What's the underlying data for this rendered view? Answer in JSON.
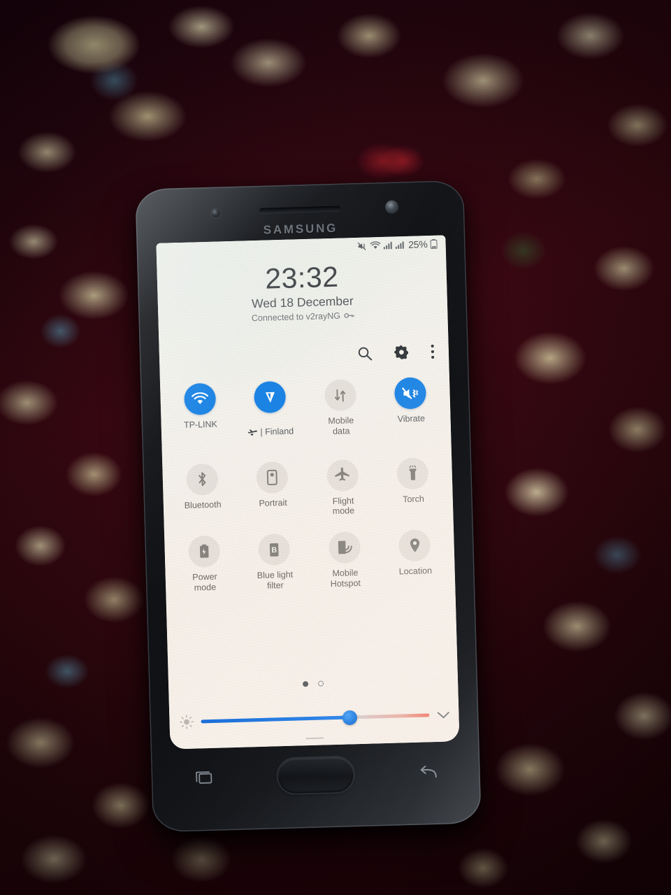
{
  "device": {
    "brand": "SAMSUNG",
    "surface": "carpet"
  },
  "statusbar": {
    "icons": [
      "mute-vibrate-icon",
      "wifi-icon",
      "signal-bars-icon",
      "signal-bars-icon"
    ],
    "battery_percent": "25%",
    "battery_icon": "battery-icon"
  },
  "lockscreen": {
    "time": "23:32",
    "date": "Wed 18 December",
    "vpn_status": "Connected to v2rayNG",
    "vpn_icon": "vpn-key-icon"
  },
  "header_actions": [
    {
      "name": "search-icon",
      "label": "Search"
    },
    {
      "name": "gear-icon",
      "label": "Settings"
    },
    {
      "name": "more-vert-icon",
      "label": "More options"
    }
  ],
  "quick_settings": {
    "tiles": [
      {
        "label": "TP-LINK",
        "icon": "wifi-icon",
        "active": true,
        "prefix_icon": null
      },
      {
        "label": "| Finland",
        "icon": "v2ray-v-icon",
        "active": true,
        "prefix_icon": "airplane-small-icon"
      },
      {
        "label": "Mobile\ndata",
        "icon": "mobile-data-icon",
        "active": false,
        "prefix_icon": null
      },
      {
        "label": "Vibrate",
        "icon": "vibrate-icon",
        "active": true,
        "prefix_icon": null
      },
      {
        "label": "Bluetooth",
        "icon": "bluetooth-icon",
        "active": false,
        "prefix_icon": null
      },
      {
        "label": "Portrait",
        "icon": "portrait-rotate-icon",
        "active": false,
        "prefix_icon": null
      },
      {
        "label": "Flight\nmode",
        "icon": "airplane-icon",
        "active": false,
        "prefix_icon": null
      },
      {
        "label": "Torch",
        "icon": "flashlight-icon",
        "active": false,
        "prefix_icon": null
      },
      {
        "label": "Power\nmode",
        "icon": "power-battery-icon",
        "active": false,
        "prefix_icon": null
      },
      {
        "label": "Blue light\nfilter",
        "icon": "blue-light-icon",
        "active": false,
        "prefix_icon": null
      },
      {
        "label": "Mobile\nHotspot",
        "icon": "hotspot-icon",
        "active": false,
        "prefix_icon": null
      },
      {
        "label": "Location",
        "icon": "location-pin-icon",
        "active": false,
        "prefix_icon": null
      }
    ],
    "page_dots": {
      "total": 2,
      "active_index": 0
    }
  },
  "brightness": {
    "icon": "brightness-icon",
    "value_percent": 65,
    "expand_icon": "chevron-down-icon"
  },
  "navigation": {
    "recents": "recents-icon",
    "home": "home-button",
    "back": "back-icon"
  },
  "colors": {
    "accent_blue": "#1781e3",
    "slider_blue": "#1474e0",
    "panel_bg": "#f3f1ea",
    "text_primary": "#44484b",
    "text_secondary": "#5a5e62",
    "carpet_maroon": "#3a0912",
    "carpet_cream": "#ded4aa"
  }
}
